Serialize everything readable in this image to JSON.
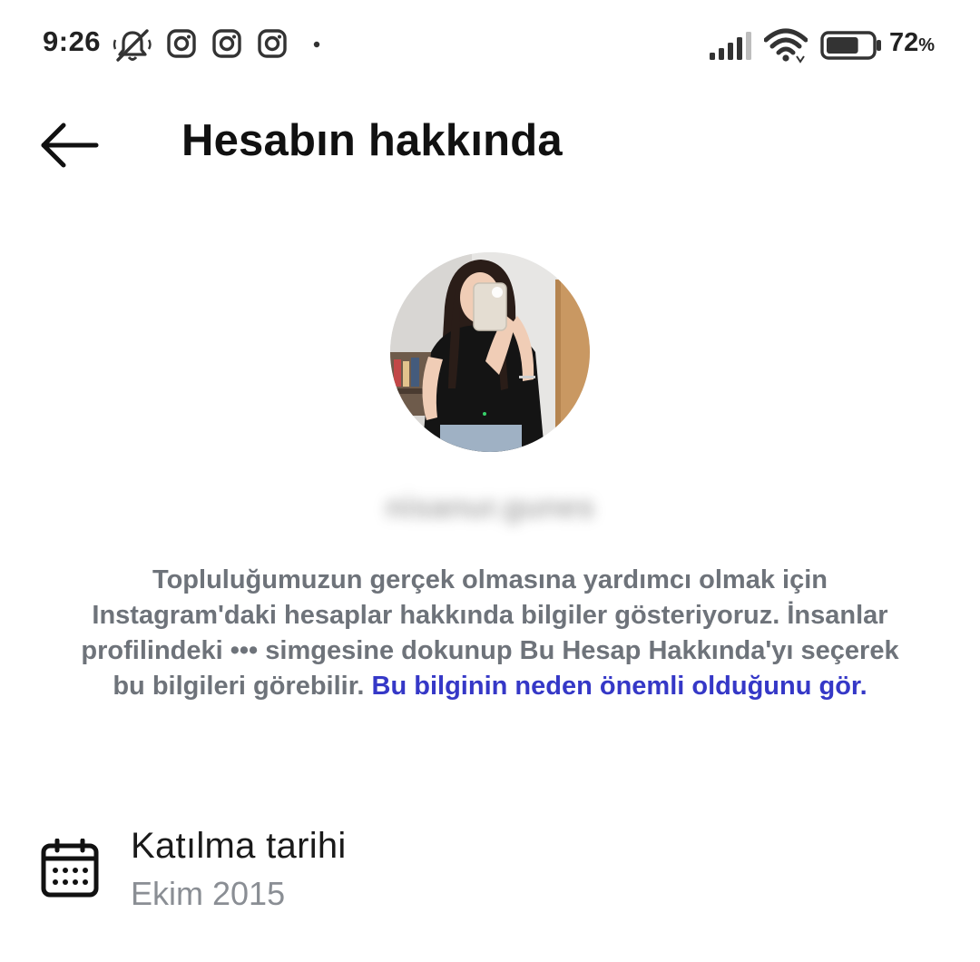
{
  "status_bar": {
    "time": "9:26",
    "battery_level": "72",
    "battery_unit": "%",
    "battery_fraction": 0.72,
    "icons": [
      "mute-bell-icon",
      "instagram-icon",
      "instagram-icon",
      "instagram-icon",
      "dot-icon",
      "signal-icon",
      "wifi-icon",
      "battery-icon"
    ]
  },
  "header": {
    "title": "Hesabın hakkında",
    "back_icon": "arrow-left-icon"
  },
  "profile": {
    "username": "nisanur.gunes"
  },
  "description": {
    "text": "Topluluğumuzun gerçek olmasına yardımcı olmak için Instagram'daki hesaplar hakkında bilgiler gösteriyoruz. İnsanlar profilindeki ••• simgesine dokunup Bu Hesap Hakkında'yı seçerek bu bilgileri görebilir.",
    "link": "Bu bilginin neden önemli olduğunu gör."
  },
  "joined": {
    "icon": "calendar-icon",
    "label": "Katılma tarihi",
    "value": "Ekim 2015"
  },
  "colors": {
    "link": "#3538c7",
    "body_text": "#6e737a",
    "secondary_text": "#8a8e94"
  }
}
